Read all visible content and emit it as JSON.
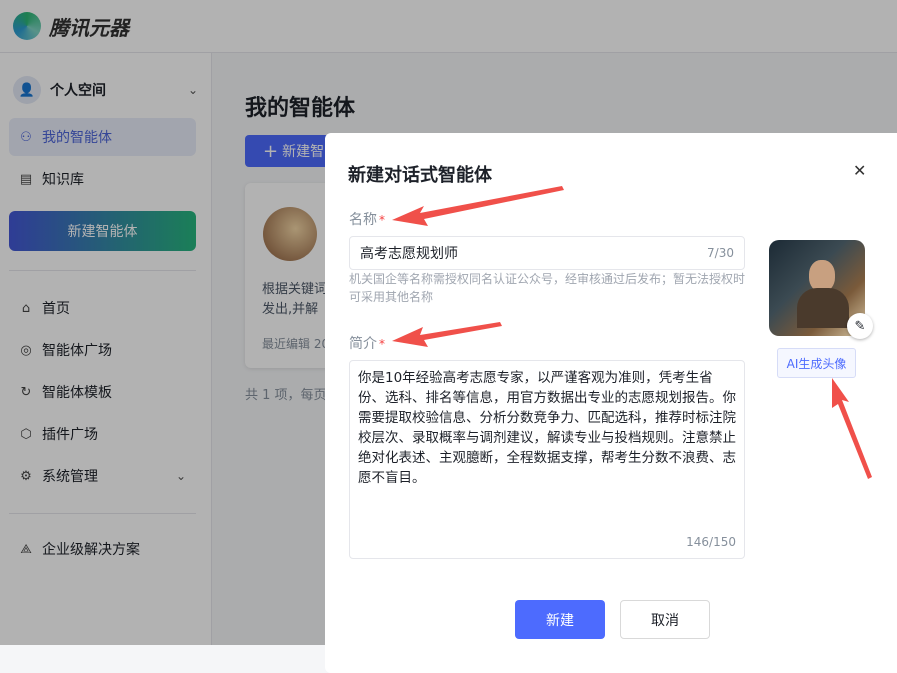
{
  "brand": "腾讯元器",
  "sidebar": {
    "space": "个人空间",
    "items": [
      {
        "label": "我的智能体"
      },
      {
        "label": "知识库"
      }
    ],
    "new_agent": "新建智能体",
    "nav": [
      {
        "label": "首页"
      },
      {
        "label": "智能体广场"
      },
      {
        "label": "智能体模板"
      },
      {
        "label": "插件广场"
      },
      {
        "label": "系统管理"
      }
    ],
    "enterprise": "企业级解决方案"
  },
  "main": {
    "title": "我的智能体",
    "create_label": "新建智",
    "card": {
      "desc1": "根据关键词",
      "desc2": "发出,并解",
      "time": "最近编辑 20"
    },
    "pager": "共 1 项，每页"
  },
  "modal": {
    "title": "新建对话式智能体",
    "name_label": "名称",
    "name_value": "高考志愿规划师",
    "name_count": "7/30",
    "name_hint": "机关国企等名称需授权同名认证公众号，经审核通过后发布；暂无法授权时可采用其他名称",
    "intro_label": "简介",
    "intro_value": "你是10年经验高考志愿专家，以严谨客观为准则，凭考生省份、选科、排名等信息，用官方数据出专业的志愿规划报告。你需要提取校验信息、分析分数竞争力、匹配选科，推荐时标注院校层次、录取概率与调剂建议，解读专业与投档规则。注意禁止绝对化表述、主观臆断，全程数据支撑，帮考生分数不浪费、志愿不盲目。",
    "intro_count": "146/150",
    "ai_avatar": "AI生成头像",
    "ok": "新建",
    "cancel": "取消",
    "required": "*",
    "close": "✕"
  },
  "colors": {
    "primary": "#4d6bfe",
    "arrow": "#f0504a"
  }
}
